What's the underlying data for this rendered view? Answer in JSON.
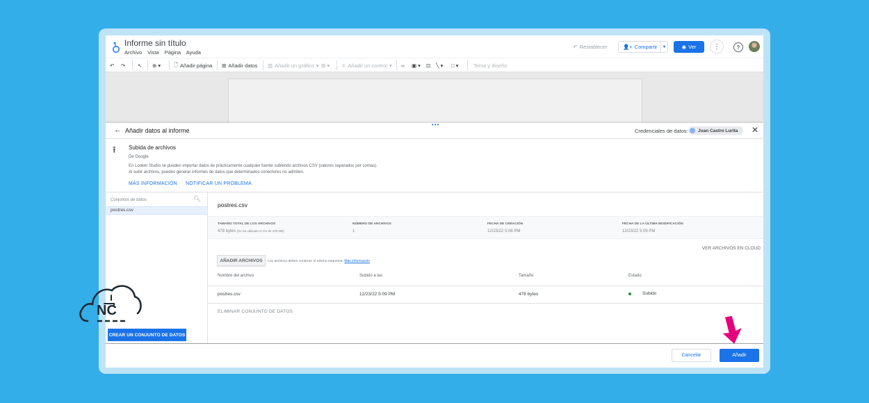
{
  "app": {
    "title": "Informe sin título",
    "menu": [
      "Archivo",
      "Vista",
      "Página",
      "Ayuda"
    ],
    "reset_label": "Restablecer",
    "share_label": "Compartir",
    "view_label": "Ver"
  },
  "toolbar": {
    "add_page": "Añadir página",
    "add_data": "Añadir datos",
    "add_chart": "Añadir un gráfico",
    "add_control": "Añadir un control",
    "theme": "Tema y diseño"
  },
  "panel": {
    "title": "Añadir datos al informe",
    "credentials_label": "Credenciales de datos:",
    "credentials_user": "Juan Castro Lurita"
  },
  "connector": {
    "name": "Subida de archivos",
    "by": "De Google",
    "description": "En Looker Studio se pueden importar datos de prácticamente cualquier fuente subiendo archivos CSV (valores separados por comas). Al subir archivos, puedes generar informes de datos que determinados conectores no admiten.",
    "more_info": "MÁS INFORMACIÓN",
    "report_issue": "NOTIFICAR UN PROBLEMA"
  },
  "datasets": {
    "search_placeholder": "Conjuntos de datos",
    "items": [
      "postres.csv"
    ],
    "create_button": "CREAR UN CONJUNTO DE DATOS"
  },
  "detail": {
    "file_title": "postres.csv",
    "stats": [
      {
        "header": "TAMAÑO TOTAL DE LOS ARCHIVOS",
        "value": "478 bytes",
        "note": "(Se ha utilizado el 1% de 100 MB)"
      },
      {
        "header": "NÚMERO DE ARCHIVOS",
        "value": "1"
      },
      {
        "header": "FECHA DE CREACIÓN",
        "value": "12/23/22 5:08 PM"
      },
      {
        "header": "FECHA DE LA ÚLTIMA MODIFICACIÓN",
        "value": "12/23/22 5:09 PM"
      }
    ],
    "cloud_link": "VER ARCHIVOS EN CLOUD",
    "add_files": "AÑADIR ARCHIVOS",
    "add_note": "Los archivos deben contener el mismo esquema.",
    "add_note_link": "Más información",
    "columns": [
      "Nombre del archivo",
      "Subido a las",
      "Tamaño",
      "Estado"
    ],
    "rows": [
      {
        "name": "postres.csv",
        "uploaded": "12/23/22 5:09 PM",
        "size": "478 bytes",
        "status": "Subido"
      }
    ],
    "delete_label": "ELIMINAR CONJUNTO DE DATOS"
  },
  "footer": {
    "cancel": "Cancelar",
    "add": "Añadir"
  },
  "overlay": {
    "logo_text": "NC"
  },
  "colors": {
    "background": "#33aee8",
    "accent": "#1a73e8",
    "arrow": "#e6007e",
    "status_ok": "#1e8e3e"
  }
}
